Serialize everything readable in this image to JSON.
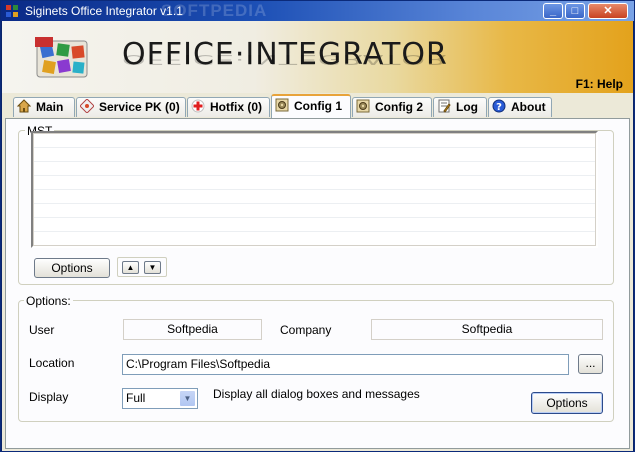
{
  "window": {
    "title": "Siginets Office Integrator v1.1",
    "watermark": "SOFTPEDIA",
    "controls": {
      "minimize": "_",
      "maximize": "□",
      "close": "✕"
    }
  },
  "banner": {
    "title": "OFFICE·INTEGRATOR",
    "help": "F1: Help"
  },
  "tabs": [
    {
      "label": "Main",
      "icon": "home-icon"
    },
    {
      "label": "Service PK (0)",
      "icon": "service-pack-icon"
    },
    {
      "label": "Hotfix (0)",
      "icon": "hotfix-icon"
    },
    {
      "label": "Config 1",
      "icon": "config-icon",
      "active": true
    },
    {
      "label": "Config 2",
      "icon": "config-icon"
    },
    {
      "label": "Log",
      "icon": "log-icon"
    },
    {
      "label": "About",
      "icon": "help-icon"
    }
  ],
  "mst": {
    "group_label": "MST",
    "options_button": "Options",
    "up_arrow": "▲",
    "down_arrow": "▼"
  },
  "options": {
    "group_label": "Options:",
    "user_label": "User",
    "user_value": "Softpedia",
    "company_label": "Company",
    "company_value": "Softpedia",
    "location_label": "Location",
    "location_value": "C:\\Program Files\\Softpedia",
    "browse_button": "...",
    "display_label": "Display",
    "display_value": "Full",
    "display_description": "Display all dialog boxes and messages",
    "options_button": "Options"
  },
  "colors": {
    "titlebar": "#0a2a86",
    "active_tab_accent": "#e8a33a",
    "banner_gold": "#e3a21c"
  }
}
